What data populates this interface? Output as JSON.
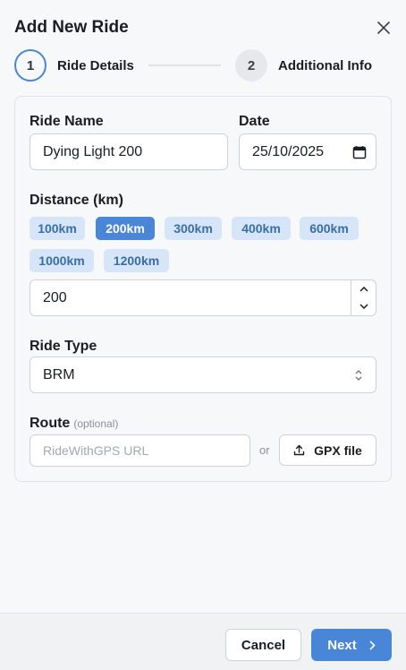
{
  "header": {
    "title": "Add New Ride"
  },
  "icons": {
    "close": "close-icon",
    "calendar": "calendar-icon",
    "upload": "upload-icon",
    "chevron": "chevron-right-icon"
  },
  "stepper": {
    "steps": [
      {
        "number": "1",
        "label": "Ride Details",
        "state": "active"
      },
      {
        "number": "2",
        "label": "Additional Info",
        "state": "inactive"
      }
    ]
  },
  "form": {
    "ride_name": {
      "label": "Ride Name",
      "value": "Dying Light 200"
    },
    "date": {
      "label": "Date",
      "value": "25/10/2025"
    },
    "distance": {
      "label": "Distance (km)",
      "presets": [
        "100km",
        "200km",
        "300km",
        "400km",
        "600km",
        "1000km",
        "1200km"
      ],
      "selected": "200km",
      "value": "200"
    },
    "ride_type": {
      "label": "Ride Type",
      "value": "BRM"
    },
    "route": {
      "label": "Route",
      "optional": "(optional)",
      "placeholder": "RideWithGPS URL",
      "or": "or",
      "gpx_label": "GPX file"
    }
  },
  "footer": {
    "cancel": "Cancel",
    "next": "Next"
  },
  "colors": {
    "accent": "#4a86d8",
    "chip_bg": "#d6e5f7",
    "chip_text": "#3a6ea8"
  }
}
